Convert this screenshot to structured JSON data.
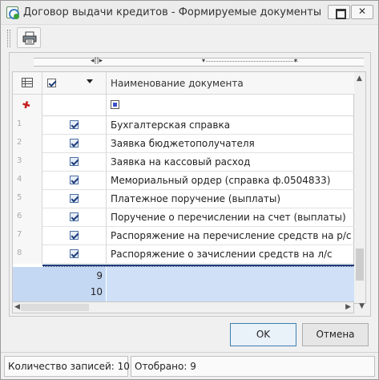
{
  "window": {
    "title": "Договор выдачи кредитов - Формируемые документы"
  },
  "toolbar": {
    "print_icon": "printer-icon"
  },
  "grid": {
    "header_name": "Наименование документа",
    "rows": [
      {
        "num": "1",
        "checked": true,
        "name": "Бухгалтерская справка"
      },
      {
        "num": "2",
        "checked": true,
        "name": "Заявка бюджетополучателя"
      },
      {
        "num": "3",
        "checked": true,
        "name": "Заявка на кассовый расход"
      },
      {
        "num": "4",
        "checked": true,
        "name": "Мемориальный ордер (справка ф.0504833)"
      },
      {
        "num": "5",
        "checked": true,
        "name": "Платежное поручение (выплаты)"
      },
      {
        "num": "6",
        "checked": true,
        "name": "Поручение о перечислении на счет (выплаты)"
      },
      {
        "num": "7",
        "checked": true,
        "name": "Распоряжение на перечисление средств на р/с"
      },
      {
        "num": "8",
        "checked": true,
        "name": "Распоряжение о зачислении средств на л/с"
      }
    ],
    "summary": [
      "9",
      "10"
    ]
  },
  "buttons": {
    "ok": "OK",
    "cancel": "Отмена"
  },
  "status": {
    "records": "Количество записей: 10",
    "selected": "Отобрано: 9"
  },
  "colors": {
    "summary_bg": "#cfe0f7",
    "separator": "#1f3d7a"
  }
}
